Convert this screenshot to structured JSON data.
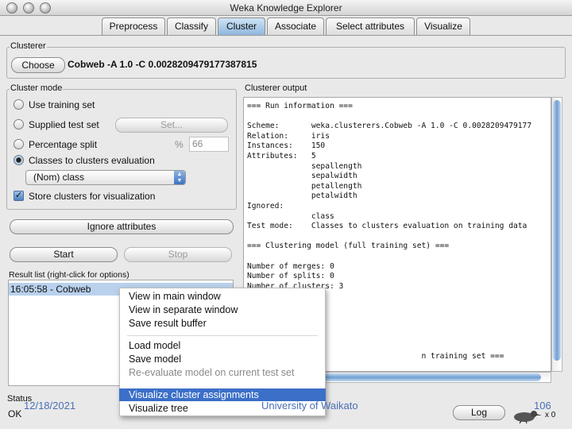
{
  "window": {
    "title": "Weka Knowledge Explorer"
  },
  "tabs": [
    {
      "label": "Preprocess",
      "active": false
    },
    {
      "label": "Classify",
      "active": false
    },
    {
      "label": "Cluster",
      "active": true
    },
    {
      "label": "Associate",
      "active": false
    },
    {
      "label": "Select attributes",
      "active": false
    },
    {
      "label": "Visualize",
      "active": false
    }
  ],
  "clusterer": {
    "group_title": "Clusterer",
    "choose_label": "Choose",
    "spec": "Cobweb -A 1.0 -C 0.0028209479177387815"
  },
  "cluster_mode": {
    "group_title": "Cluster mode",
    "options": [
      {
        "label": "Use training set",
        "selected": false
      },
      {
        "label": "Supplied test set",
        "selected": false
      },
      {
        "label": "Percentage split",
        "selected": false
      },
      {
        "label": "Classes to clusters evaluation",
        "selected": true
      }
    ],
    "set_button": "Set...",
    "percent_symbol": "%",
    "percent_value": "66",
    "class_select": "(Nom) class",
    "store_label": "Store clusters for visualization",
    "store_checked": true
  },
  "buttons": {
    "ignore_attributes": "Ignore attributes",
    "start": "Start",
    "stop": "Stop"
  },
  "result_list": {
    "group_title": "Result list (right-click for options)",
    "items": [
      "16:05:58 - Cobweb"
    ]
  },
  "output": {
    "group_title": "Clusterer output",
    "lines": [
      "=== Run information ===",
      "",
      "Scheme:       weka.clusterers.Cobweb -A 1.0 -C 0.0028209479177",
      "Relation:     iris",
      "Instances:    150",
      "Attributes:   5",
      "              sepallength",
      "              sepalwidth",
      "              petallength",
      "              petalwidth",
      "Ignored:",
      "              class",
      "Test mode:    Classes to clusters evaluation on training data",
      "",
      "=== Clustering model (full training set) ===",
      "",
      "Number of merges: 0",
      "Number of splits: 0",
      "Number of clusters: 3",
      "",
      "",
      "",
      "",
      "",
      "",
      "                                      n training set ==="
    ]
  },
  "context_menu": {
    "items": [
      {
        "label": "View in main window",
        "disabled": false,
        "highlighted": false
      },
      {
        "label": "View in separate window",
        "disabled": false,
        "highlighted": false
      },
      {
        "label": "Save result buffer",
        "disabled": false,
        "highlighted": false
      },
      {
        "label": "Load model",
        "disabled": false,
        "highlighted": false
      },
      {
        "label": "Save model",
        "disabled": false,
        "highlighted": false
      },
      {
        "label": "Re-evaluate model on current test set",
        "disabled": true,
        "highlighted": false
      },
      {
        "label": "Visualize cluster assignments",
        "disabled": false,
        "highlighted": true
      },
      {
        "label": "Visualize tree",
        "disabled": false,
        "highlighted": false
      }
    ]
  },
  "status": {
    "group_title": "Status",
    "text": "OK",
    "log_label": "Log",
    "x_count": "x 0"
  },
  "slide_overlay": {
    "date": "12/18/2021",
    "org": "University of Waikato",
    "page": "106"
  },
  "icons": [
    "close-light-icon",
    "minimize-light-icon",
    "zoom-light-icon",
    "weka-bird-icon",
    "stepper-arrows-icon",
    "check-icon"
  ],
  "colors": {
    "active_tab": "#9fc2e6",
    "selection": "#3b6fc8",
    "overlay_text": "#4a6fb5"
  }
}
